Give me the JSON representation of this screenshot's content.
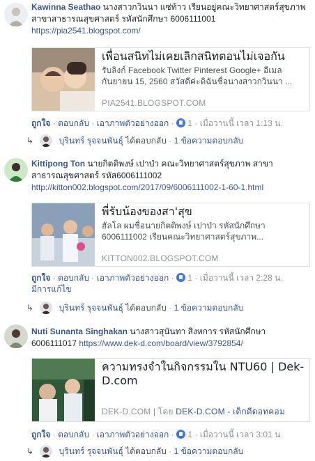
{
  "comments": [
    {
      "author": "Kawinna Seathao",
      "text": "นางสาวกวินนา แซ่ท้าว เรียนอยู่คณะวิทยาศาสตร์สุขภาพ สาขาสาธารณสุขศาสตร์ รหัสนักศึกษา 6006111001",
      "url": "https://pia2541.blogspot.com/",
      "card": {
        "title": "เพื่อนสนิทไม่เคยเลิกสนิทตอนไม่เจอกัน",
        "desc1": "รับลิงก์ Facebook Twitter Pinterest Google+ อีเมล",
        "desc2": "กันยายน 15, 2560 สวัสดีค่ะดิฉันชื่อนางสาวกวินนา ...",
        "site": "PIA2541.BLOGSPOT.COM"
      },
      "actions": {
        "like": "ถูกใจ",
        "reply": "ตอบกลับ",
        "preview": "เอาภาพตัวอย่างออก",
        "count": "1",
        "time": "เมื่อวานนี้ เวลา 1:13 น."
      },
      "reply_row": {
        "name": "บุรินทร์ รุจจนพันธุ์",
        "action": "ได้ตอบกลับ",
        "count": "1 ข้อความตอบกลับ"
      }
    },
    {
      "author": "Kittipong Ton",
      "text": "นายกิตติพงษ์ เปาป่า คณะวิทยาศาสตร์สุขภาพ สาขาสาธารณสุขศาสตร์ รหัส6006111002",
      "url": "http://kitton002.blogspot.com/2017/09/6006111002-1-60-1.html",
      "card": {
        "title": "พี่รับน้องของสา'สุข",
        "desc1": "ฮัลโล ผมชื่อนายกิตติพงษ์ เปาป่า รหัสนักศึกษา",
        "desc2": "6006111002 เรียนคณะวิทยาศาสตร์สุขภาพ...",
        "site": "KITTON002.BLOGSPOT.COM"
      },
      "actions": {
        "like": "ถูกใจ",
        "reply": "ตอบกลับ",
        "preview": "เอาภาพตัวอย่างออก",
        "count": "1",
        "time": "เมื่อวานนี้ เวลา 2:28 น.",
        "edited": "มีการแก้ไข"
      },
      "reply_row": {
        "name": "บุรินทร์ รุจจนพันธุ์",
        "action": "ได้ตอบกลับ",
        "count": "1 ข้อความตอบกลับ"
      }
    },
    {
      "author": "Nuti Sunanta Singhakan",
      "text": "นางสาวสุนันทา สิงหการ รหัสนักศึกษา 6006111017",
      "url": "https://www.dek-d.com/board/view/3792854/",
      "card": {
        "title": "ความทรงจำในกิจกรรมใน NTU60 | Dek-D.com",
        "site_a": "DEK-D.COM",
        "by": "โดย",
        "site_b": "DEK-D.COM - เด็กดีดอทคอม"
      },
      "actions": {
        "like": "ถูกใจ",
        "reply": "ตอบกลับ",
        "preview": "เอาภาพตัวอย่างออก",
        "count": "1",
        "time": "เมื่อวานนี้ เวลา 3:01 น."
      },
      "reply_row": {
        "name": "บุรินทร์ รุจจนพันธุ์",
        "action": "ได้ตอบกลับ",
        "count": "1 ข้อความตอบกลับ"
      }
    }
  ],
  "colors": {
    "link": "#385898",
    "meta": "#90949c",
    "like_blue": "#3b78e7"
  }
}
